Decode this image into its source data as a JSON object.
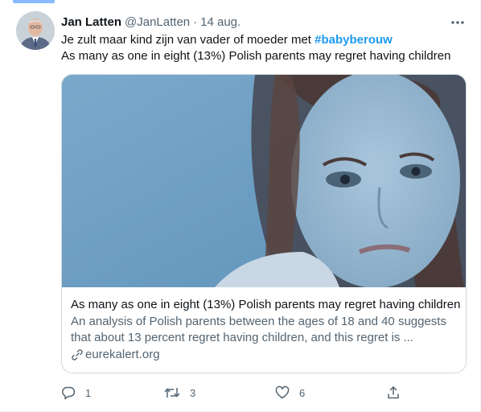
{
  "tweet": {
    "author_name": "Jan Latten",
    "author_handle": "@JanLatten",
    "separator": "·",
    "date": "14 aug.",
    "text_before": "Je zult maar kind zijn van vader of moeder met ",
    "hashtag": "#babyberouw",
    "text_line2": "As many as one in eight (13%) Polish parents may regret having children"
  },
  "card": {
    "title": "As many as one in eight (13%) Polish parents may regret having children",
    "description": "An analysis of Polish parents between the ages of 18 and 40 suggests that about 13 percent regret having children, and this regret is ...",
    "domain": "eurekalert.org"
  },
  "actions": {
    "reply_count": "1",
    "retweet_count": "3",
    "like_count": "6"
  },
  "colors": {
    "accent": "#1d9bf0",
    "secondary_text": "#536471",
    "border": "#cfd9de"
  },
  "icons": [
    "more-icon",
    "link-icon",
    "reply-icon",
    "retweet-icon",
    "like-icon",
    "share-icon"
  ]
}
